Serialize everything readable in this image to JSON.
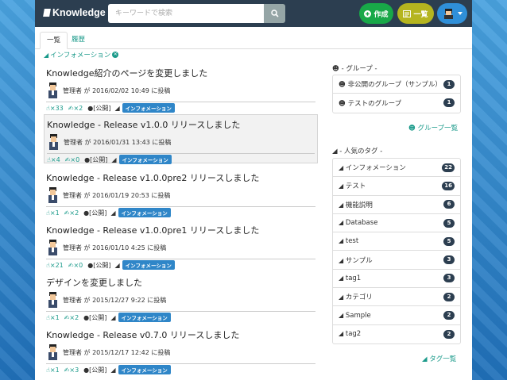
{
  "nav": {
    "brand": "Knowledge",
    "search_placeholder": "キーワードで検索",
    "create_label": "作成",
    "list_label": "一覧"
  },
  "tabs": [
    {
      "label": "一覧"
    },
    {
      "label": "履歴"
    }
  ],
  "filter": {
    "tag": "インフォメーション"
  },
  "items": [
    {
      "title": "Knowledge紹介のページを変更しました",
      "meta": "管理者 が 2016/02/02 10:49 に投稿",
      "likes": "×33",
      "comments": "×2",
      "visibility": "[公開]",
      "tag": "インフォメーション"
    },
    {
      "title": "Knowledge - Release v1.0.0 リリースしました",
      "meta": "管理者 が 2016/01/31 13:43 に投稿",
      "likes": "×4",
      "comments": "×0",
      "visibility": "[公開]",
      "tag": "インフォメーション"
    },
    {
      "title": "Knowledge - Release v1.0.0pre2 リリースしました",
      "meta": "管理者 が 2016/01/19 20:53 に投稿",
      "likes": "×1",
      "comments": "×2",
      "visibility": "[公開]",
      "tag": "インフォメーション"
    },
    {
      "title": "Knowledge - Release v1.0.0pre1 リリースしました",
      "meta": "管理者 が 2016/01/10 4:25 に投稿",
      "likes": "×21",
      "comments": "×0",
      "visibility": "[公開]",
      "tag": "インフォメーション"
    },
    {
      "title": "デザインを変更しました",
      "meta": "管理者 が 2015/12/27 9:22 に投稿",
      "likes": "×1",
      "comments": "×2",
      "visibility": "[公開]",
      "tag": "インフォメーション"
    },
    {
      "title": "Knowledge - Release v0.7.0 リリースしました",
      "meta": "管理者 が 2015/12/17 12:42 に投稿",
      "likes": "×1",
      "comments": "×3",
      "visibility": "[公開]",
      "tag": "インフォメーション"
    }
  ],
  "groups": {
    "heading": "- グループ -",
    "items": [
      {
        "name": "非公開のグループ（サンプル）",
        "count": "1"
      },
      {
        "name": "テストのグループ",
        "count": "1"
      }
    ],
    "more_label": "グループ一覧"
  },
  "tags": {
    "heading": "- 人気のタグ -",
    "items": [
      {
        "name": "インフォメーション",
        "count": "22"
      },
      {
        "name": "テスト",
        "count": "16"
      },
      {
        "name": "機能説明",
        "count": "6"
      },
      {
        "name": "Database",
        "count": "5"
      },
      {
        "name": "test",
        "count": "5"
      },
      {
        "name": "サンプル",
        "count": "3"
      },
      {
        "name": "tag1",
        "count": "3"
      },
      {
        "name": "カテゴリ",
        "count": "2"
      },
      {
        "name": "Sample",
        "count": "2"
      },
      {
        "name": "tag2",
        "count": "2"
      }
    ],
    "more_label": "タグ一覧"
  },
  "colors": {
    "navbar": "#2c3e50",
    "accent": "#1a9a8a",
    "create": "#18a848",
    "list": "#b5b51f",
    "user": "#2f8fd8",
    "tag_badge": "#2f86c8"
  }
}
